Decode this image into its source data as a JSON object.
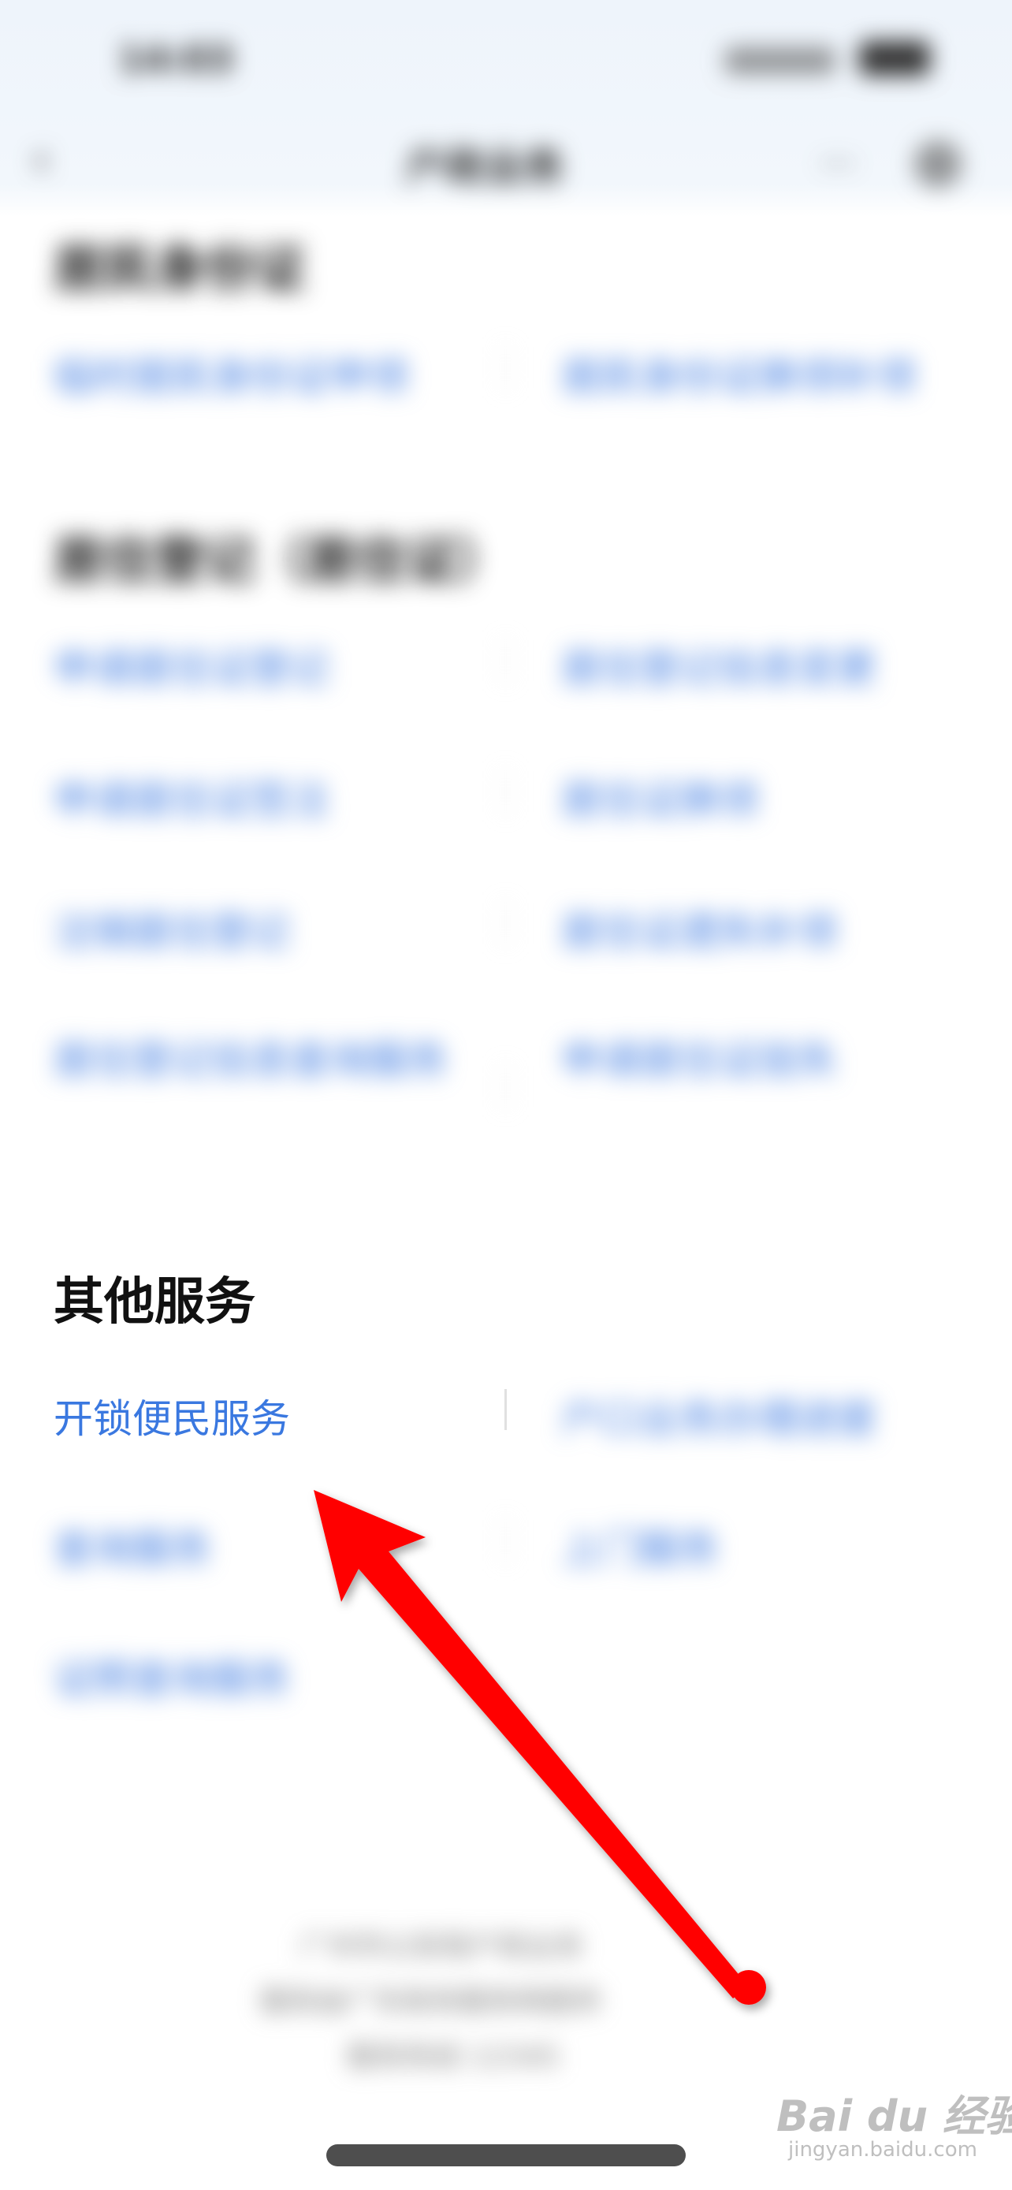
{
  "status_bar": {
    "time": "14:03",
    "battery": "84"
  },
  "nav": {
    "back_glyph": "‹",
    "title": "户政业务",
    "more_glyph": "···"
  },
  "sections": [
    {
      "title": "居民身份证",
      "links": [
        "临时居民身份证申领",
        "居民身份证换领补领"
      ]
    },
    {
      "title": "居住登记（居住证）",
      "links": [
        "申请居住证登记",
        "居住登记信息变更",
        "申请居住证签注",
        "居住证换领",
        "注销居住登记",
        "居住证遗失补领",
        "居住登记信息查询服务",
        "申请居住证挂失"
      ]
    },
    {
      "title": "其他服务",
      "links": [
        "开锁便民服务",
        "户口业务办理进度",
        "查询服务",
        "上门服务",
        "证照查询服务"
      ]
    }
  ],
  "footer": {
    "line1": "广州市公安局户政业务",
    "line2": "服务由广东政务服务网提供",
    "line3": "服务热线 12345"
  },
  "watermark": {
    "brand": "Bai du 经验",
    "url": "jingyan.baidu.com"
  },
  "colors": {
    "link": "#3a78e0",
    "arrow": "#ff0000",
    "header_bg": "#eef4fb"
  },
  "icons": {
    "back": "chevron-left-icon",
    "more": "more-icon",
    "close": "close-icon"
  }
}
